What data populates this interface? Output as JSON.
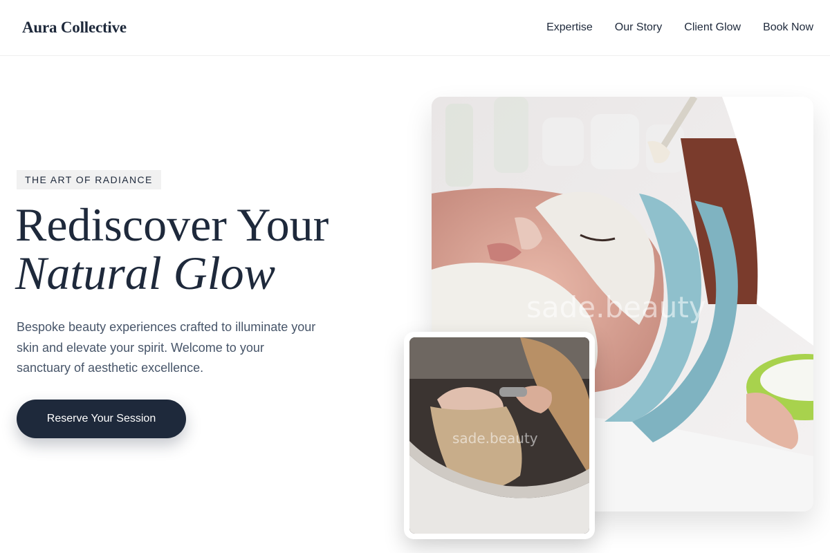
{
  "brand": {
    "name": "Aura Collective"
  },
  "nav": {
    "items": [
      {
        "label": "Expertise"
      },
      {
        "label": "Our Story"
      },
      {
        "label": "Client Glow"
      },
      {
        "label": "Book Now"
      }
    ]
  },
  "hero": {
    "eyebrow": "THE ART OF RADIANCE",
    "headline_line1": "Rediscover Your",
    "headline_line2": "Natural Glow",
    "lede": "Bespoke beauty experiences crafted to illuminate your skin and elevate your spirit. Welcome to your sanctuary of aesthetic excellence.",
    "cta_label": "Reserve Your Session"
  },
  "images": {
    "main_watermark": "sade.beauty",
    "small_watermark": "sade.beauty"
  },
  "colors": {
    "primary": "#1e293b",
    "muted_text": "#475569",
    "eyebrow_bg": "#f1f1f1"
  }
}
